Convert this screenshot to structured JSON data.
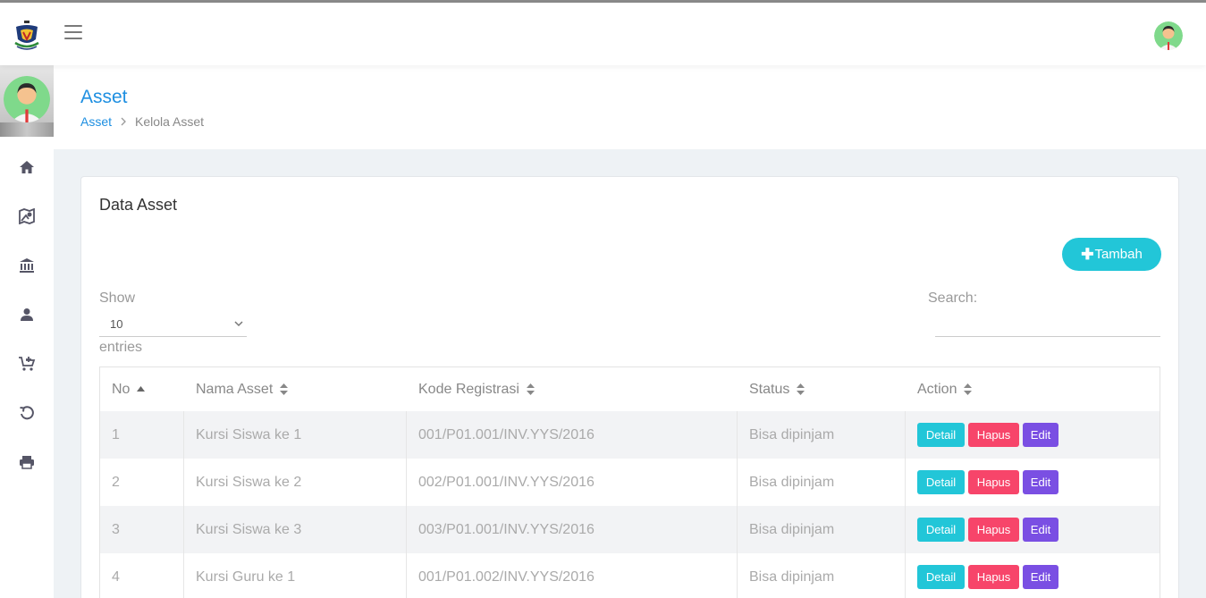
{
  "header": {
    "title": "Asset",
    "breadcrumb": [
      "Asset",
      "Kelola Asset"
    ]
  },
  "card": {
    "title": "Data Asset",
    "add_button": "Tambah"
  },
  "table_controls": {
    "show_label": "Show",
    "entries_value": "10",
    "entries_label": "entries",
    "search_label": "Search:",
    "search_value": ""
  },
  "table": {
    "columns": [
      "No",
      "Nama Asset",
      "Kode Registrasi",
      "Status",
      "Action"
    ],
    "rows": [
      {
        "no": "1",
        "nama": "Kursi Siswa ke 1",
        "kode": "001/P01.001/INV.YYS/2016",
        "status": "Bisa dipinjam"
      },
      {
        "no": "2",
        "nama": "Kursi Siswa ke 2",
        "kode": "002/P01.001/INV.YYS/2016",
        "status": "Bisa dipinjam"
      },
      {
        "no": "3",
        "nama": "Kursi Siswa ke 3",
        "kode": "003/P01.001/INV.YYS/2016",
        "status": "Bisa dipinjam"
      },
      {
        "no": "4",
        "nama": "Kursi Guru ke 1",
        "kode": "001/P01.002/INV.YYS/2016",
        "status": "Bisa dipinjam"
      }
    ],
    "actions": {
      "detail": "Detail",
      "hapus": "Hapus",
      "edit": "Edit"
    }
  },
  "sidebar": {
    "items": [
      "home-icon",
      "map-icon",
      "bank-icon",
      "user-icon",
      "cart-icon",
      "history-icon",
      "print-icon"
    ]
  },
  "colors": {
    "primary": "#1e8fe1",
    "info": "#22c6d8",
    "danger": "#f7456a",
    "purple": "#7a4fe3"
  }
}
